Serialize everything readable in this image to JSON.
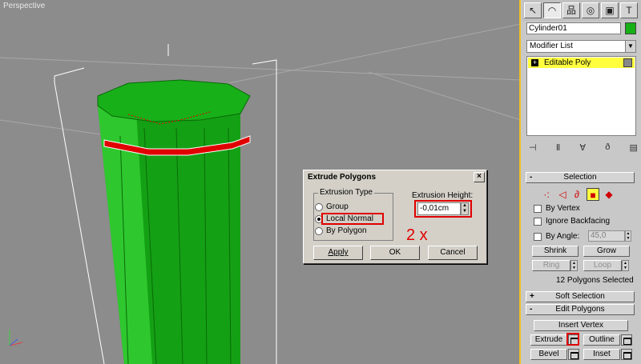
{
  "viewport": {
    "label": "Perspective",
    "colors": {
      "background": "#8c8c8c",
      "object": "#16a516",
      "selection": "#e00000",
      "border": "#f0c020"
    }
  },
  "dialog": {
    "title": "Extrude Polygons",
    "close_glyph": "×",
    "extrusion_type": {
      "label": "Extrusion Type",
      "options": [
        "Group",
        "Local Normal",
        "By Polygon"
      ],
      "selected": "Local Normal"
    },
    "extrusion_height": {
      "label": "Extrusion Height:",
      "value": "-0,01cm"
    },
    "annotation": "2 x",
    "buttons": {
      "apply": "Apply",
      "ok": "OK",
      "cancel": "Cancel"
    }
  },
  "panel": {
    "tabs": [
      {
        "icon": "pointer-icon",
        "glyph": "↖"
      },
      {
        "icon": "modify-icon",
        "glyph": "◠"
      },
      {
        "icon": "hierarchy-icon",
        "glyph": "品"
      },
      {
        "icon": "motion-icon",
        "glyph": "◎"
      },
      {
        "icon": "display-icon",
        "glyph": "▣"
      },
      {
        "icon": "utilities-icon",
        "glyph": "T"
      }
    ],
    "object_name": "Cylinder01",
    "object_color": "#16b016",
    "modifier_list": "Modifier List",
    "stack_item": "Editable Poly",
    "stack_tools": [
      {
        "icon": "pin-icon",
        "glyph": "⊣"
      },
      {
        "icon": "show-end-icon",
        "glyph": "Ⅱ"
      },
      {
        "icon": "make-unique-icon",
        "glyph": "∀"
      },
      {
        "icon": "remove-modifier-icon",
        "glyph": "ð"
      },
      {
        "icon": "configure-icon",
        "glyph": "▤"
      }
    ],
    "selection": {
      "title": "Selection",
      "sign": "-",
      "by_vertex": "By Vertex",
      "ignore_backfacing": "Ignore Backfacing",
      "by_angle": "By Angle:",
      "angle_value": "45,0",
      "shrink": "Shrink",
      "grow": "Grow",
      "ring": "Ring",
      "loop": "Loop",
      "count": "12 Polygons Selected"
    },
    "soft_selection": {
      "title": "Soft Selection",
      "sign": "+"
    },
    "edit_polygons": {
      "title": "Edit Polygons",
      "sign": "-",
      "insert_vertex": "Insert Vertex",
      "extrude": "Extrude",
      "outline": "Outline",
      "bevel": "Bevel",
      "inset": "Inset"
    }
  }
}
